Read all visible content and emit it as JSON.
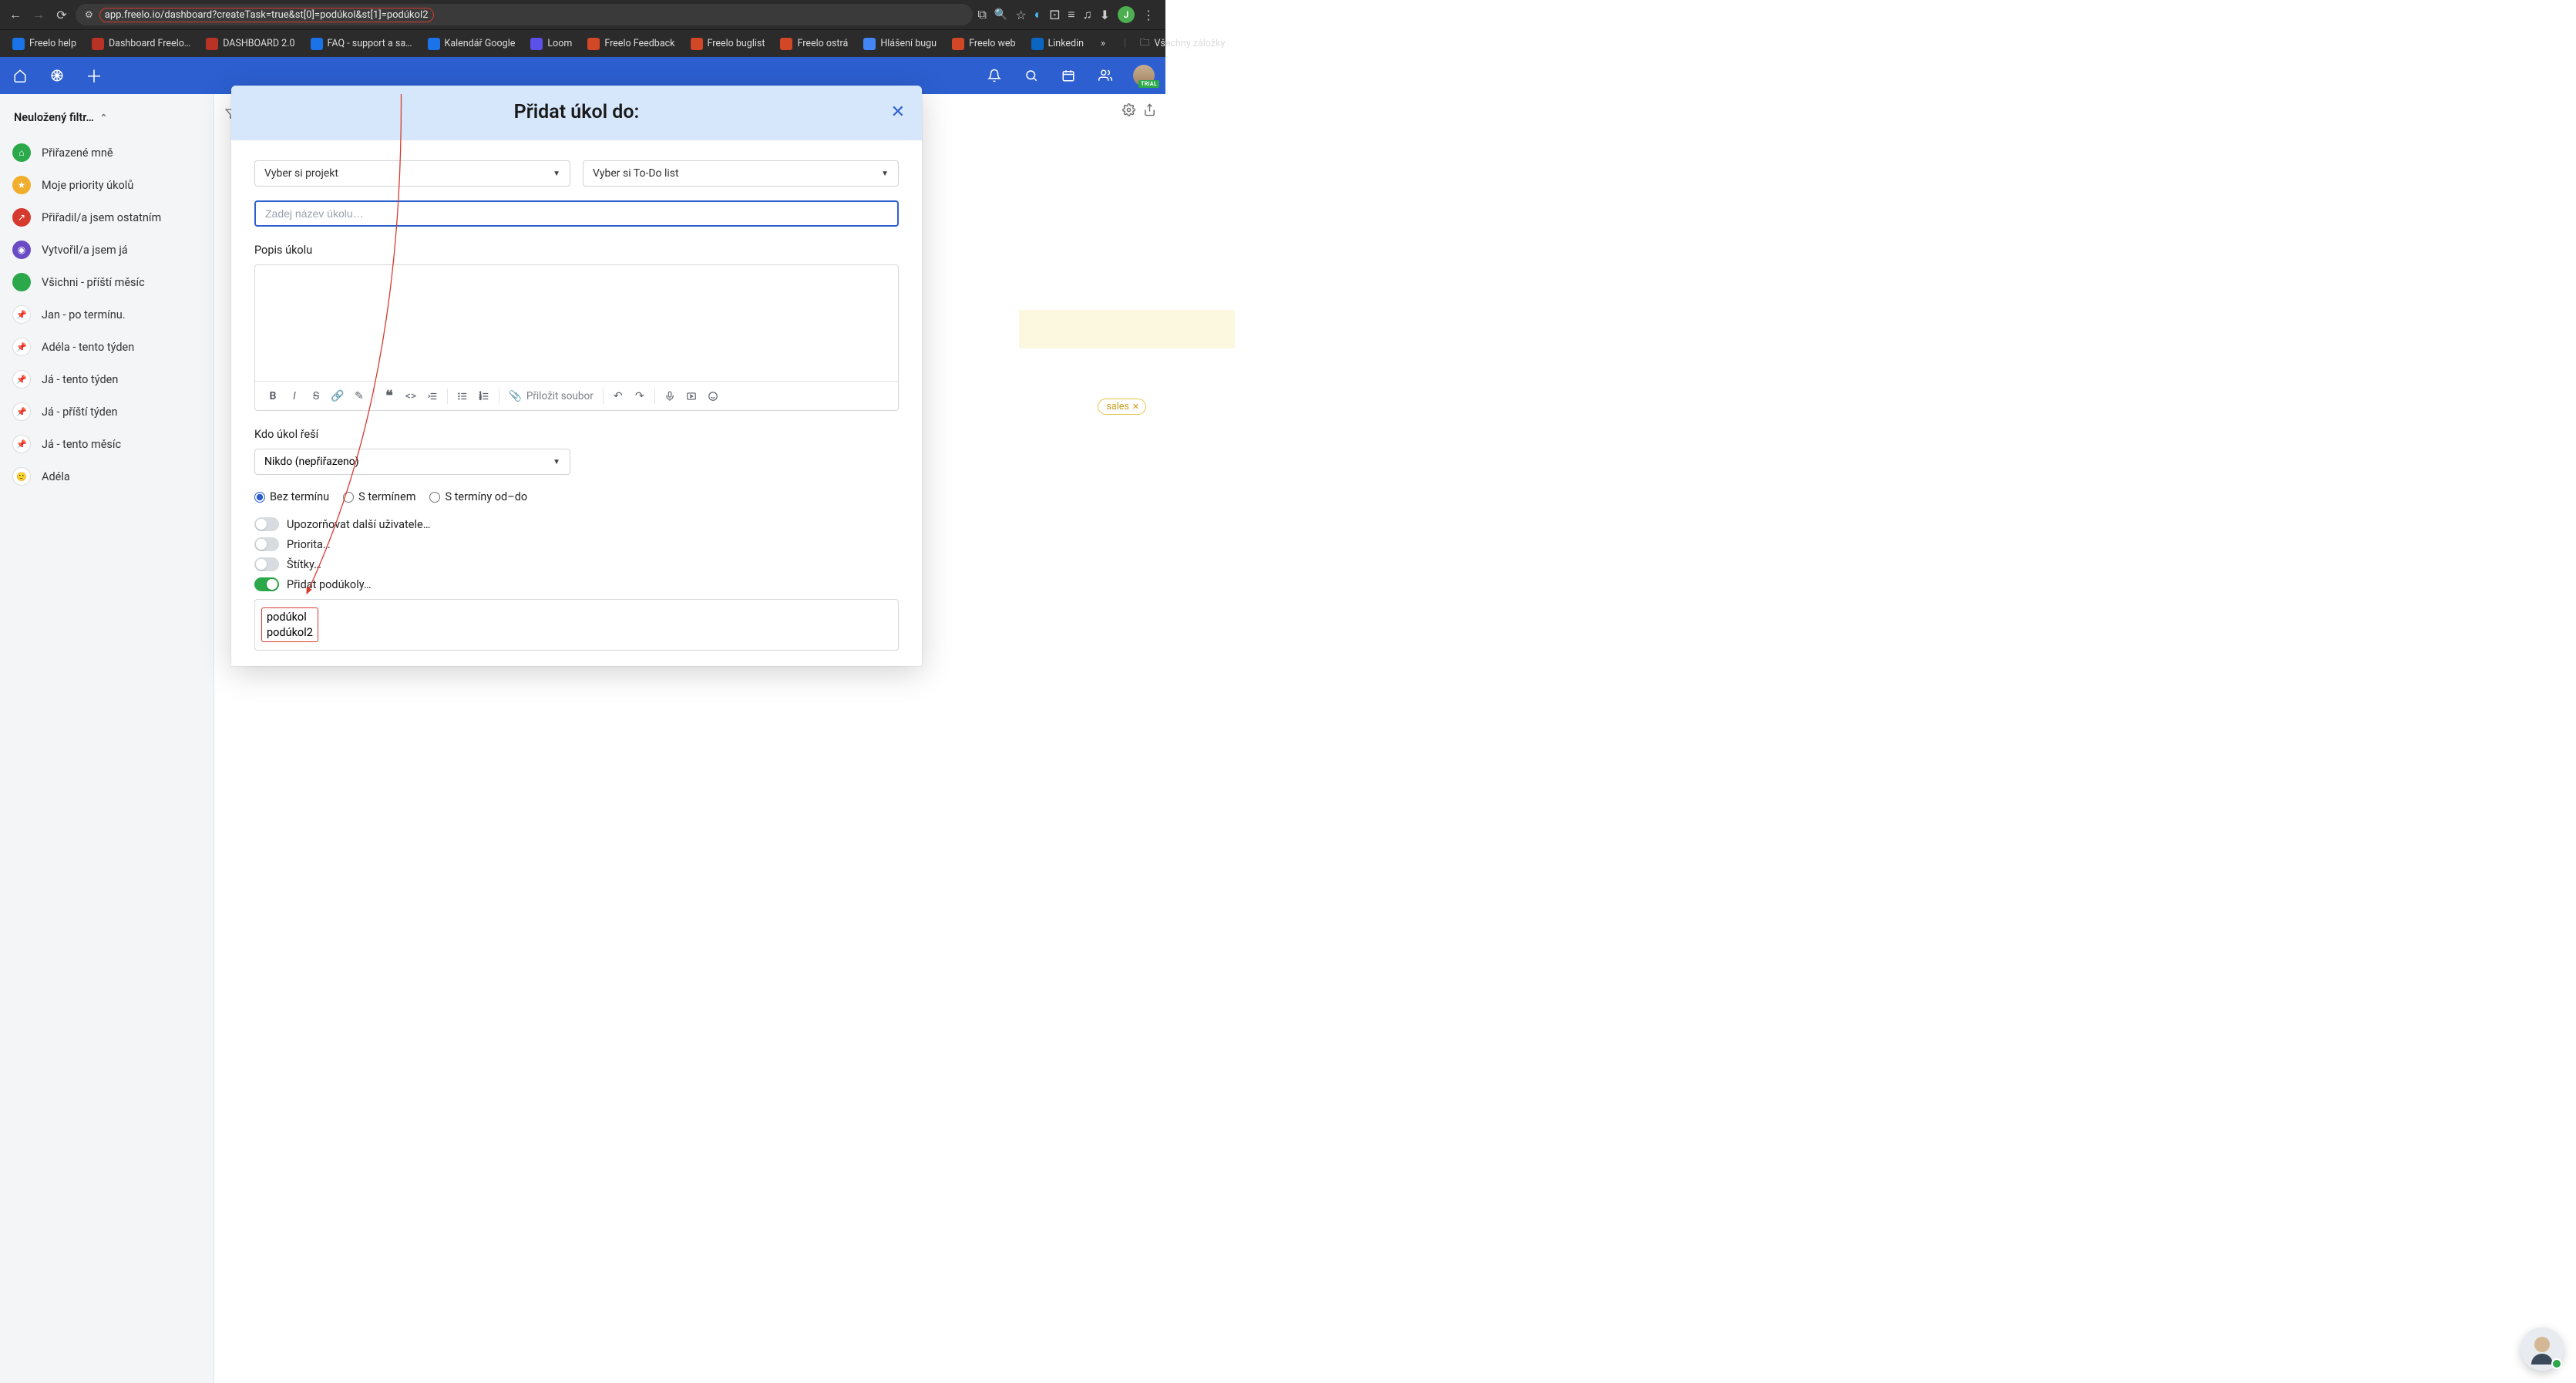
{
  "browser": {
    "url": "app.freelo.io/dashboard?createTask=true&st[0]=podúkol&st[1]=podúkol2",
    "avatar_letter": "J",
    "allBookmarks": "Všechny záložky",
    "bookmarks": [
      {
        "label": "Freelo help",
        "color": "#1a73e8"
      },
      {
        "label": "Dashboard Freelo…",
        "color": "#b83225"
      },
      {
        "label": "DASHBOARD 2.0",
        "color": "#b83225"
      },
      {
        "label": "FAQ - support a sa…",
        "color": "#1a73e8"
      },
      {
        "label": "Kalendář Google",
        "color": "#1a73e8"
      },
      {
        "label": "Loom",
        "color": "#5b51e8"
      },
      {
        "label": "Freelo Feedback",
        "color": "#d24726"
      },
      {
        "label": "Freelo buglist",
        "color": "#d24726"
      },
      {
        "label": "Freelo ostrá",
        "color": "#d24726"
      },
      {
        "label": "Hlášení bugu",
        "color": "#4285f4"
      },
      {
        "label": "Freelo web",
        "color": "#d24726"
      },
      {
        "label": "Linkedin",
        "color": "#0a66c2"
      }
    ]
  },
  "header": {
    "trial": "TRIAL"
  },
  "sidebar": {
    "title": "Neuložený filtr…",
    "items": [
      {
        "label": "Přiřazené mně",
        "color": "#2aa84a",
        "glyph": "⌂"
      },
      {
        "label": "Moje priority úkolů",
        "color": "#f0ad2e",
        "glyph": "★"
      },
      {
        "label": "Přiřadil/a jsem ostatním",
        "color": "#d63a2f",
        "glyph": "↗"
      },
      {
        "label": "Vytvořil/a jsem já",
        "color": "#6a4bc4",
        "glyph": "◉"
      },
      {
        "label": "Všichni - příští měsíc",
        "color": "#2aa84a",
        "glyph": ""
      },
      {
        "label": "Jan - po termínu.",
        "color": "#ffffff",
        "glyph": "📌"
      },
      {
        "label": "Adéla - tento týden",
        "color": "#ffffff",
        "glyph": "📌"
      },
      {
        "label": "Já - tento týden",
        "color": "#ffffff",
        "glyph": "📌"
      },
      {
        "label": "Já - příští týden",
        "color": "#ffffff",
        "glyph": "📌"
      },
      {
        "label": "Já - tento měsíc",
        "color": "#ffffff",
        "glyph": "📌"
      },
      {
        "label": "Adéla",
        "color": "#ffffff",
        "glyph": "🙂"
      }
    ]
  },
  "modal": {
    "title": "Přidat úkol do:",
    "project_placeholder": "Vyber si projekt",
    "todo_placeholder": "Vyber si To-Do list",
    "task_name_placeholder": "Zadej název úkolu…",
    "description_label": "Popis úkolu",
    "attach_label": "Přiložit soubor",
    "assignee_label": "Kdo úkol řeší",
    "assignee_value": "Nikdo (nepřiřazeno)",
    "deadline": {
      "none": "Bez termínu",
      "single": "S termínem",
      "range": "S termíny od–do"
    },
    "toggles": {
      "notify": "Upozorňovat další uživatele…",
      "priority": "Priorita…",
      "tags": "Štítky…",
      "subtasks": "Přidat podúkoly…"
    },
    "subtasks": [
      "podúkol",
      "podúkol2"
    ]
  },
  "tags": {
    "sales": "sales"
  }
}
